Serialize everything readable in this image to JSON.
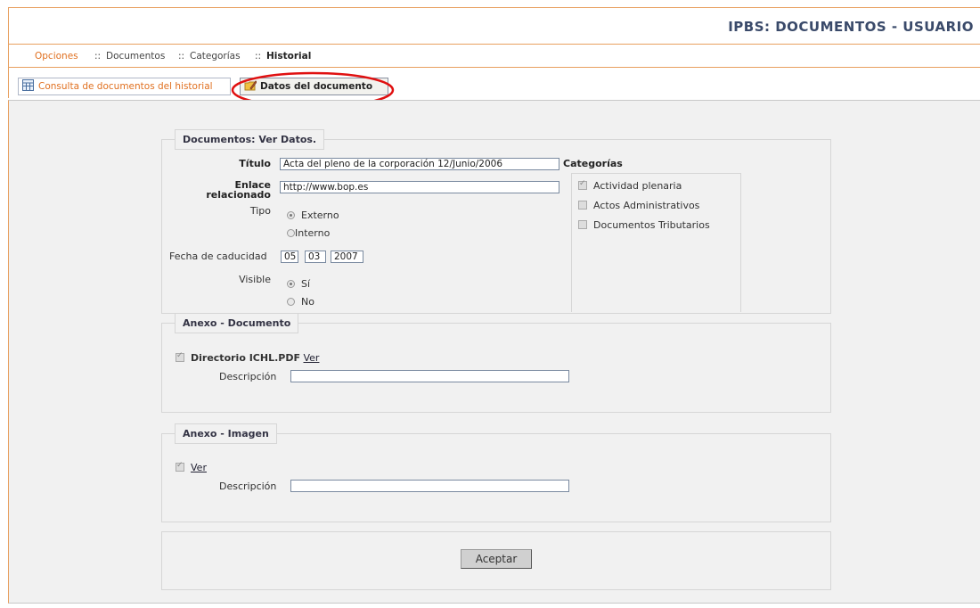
{
  "header": {
    "title": "IPBS: DOCUMENTOS - USUARIO"
  },
  "nav": {
    "options": "Opciones",
    "sep": "::",
    "documentos": "Documentos",
    "categorias": "Categorías",
    "historial": "Historial"
  },
  "tabs": [
    {
      "label": "Consulta de documentos del historial",
      "icon": "table-icon"
    },
    {
      "label": "Datos del documento",
      "icon": "edit-folder-icon",
      "active": true
    }
  ],
  "highlight_color": "#e01010",
  "form": {
    "legend": "Documentos: Ver Datos.",
    "titulo_label": "Título",
    "titulo_value": "Acta del pleno de la corporación 12/Junio/2006",
    "enlace_label": "Enlace relacionado",
    "enlace_value": "http://www.bop.es",
    "tipo_label": "Tipo",
    "tipo_options": [
      "Externo",
      "Interno"
    ],
    "tipo_selected": "Externo",
    "fecha_label": "Fecha de caducidad",
    "fecha_day": "05",
    "fecha_month": "03",
    "fecha_year": "2007",
    "visible_label": "Visible",
    "visible_options": [
      "Sí",
      "No"
    ],
    "visible_selected": "Sí",
    "categorias_label": "Categorías",
    "categorias": [
      {
        "label": "Actividad plenaria",
        "checked": true
      },
      {
        "label": "Actos Administrativos",
        "checked": false
      },
      {
        "label": "Documentos Tributarios",
        "checked": false
      }
    ]
  },
  "anexo_documento": {
    "legend": "Anexo - Documento",
    "file_name": "Directorio ICHL.PDF",
    "ver_link": "Ver",
    "descripcion_label": "Descripción",
    "descripcion_value": ""
  },
  "anexo_imagen": {
    "legend": "Anexo - Imagen",
    "ver_link": "Ver",
    "descripcion_label": "Descripción",
    "descripcion_value": ""
  },
  "actions": {
    "accept_label": "Aceptar"
  },
  "colors": {
    "accent": "#e07020",
    "title": "#3a4a6a",
    "background": "#f1f1f1"
  }
}
